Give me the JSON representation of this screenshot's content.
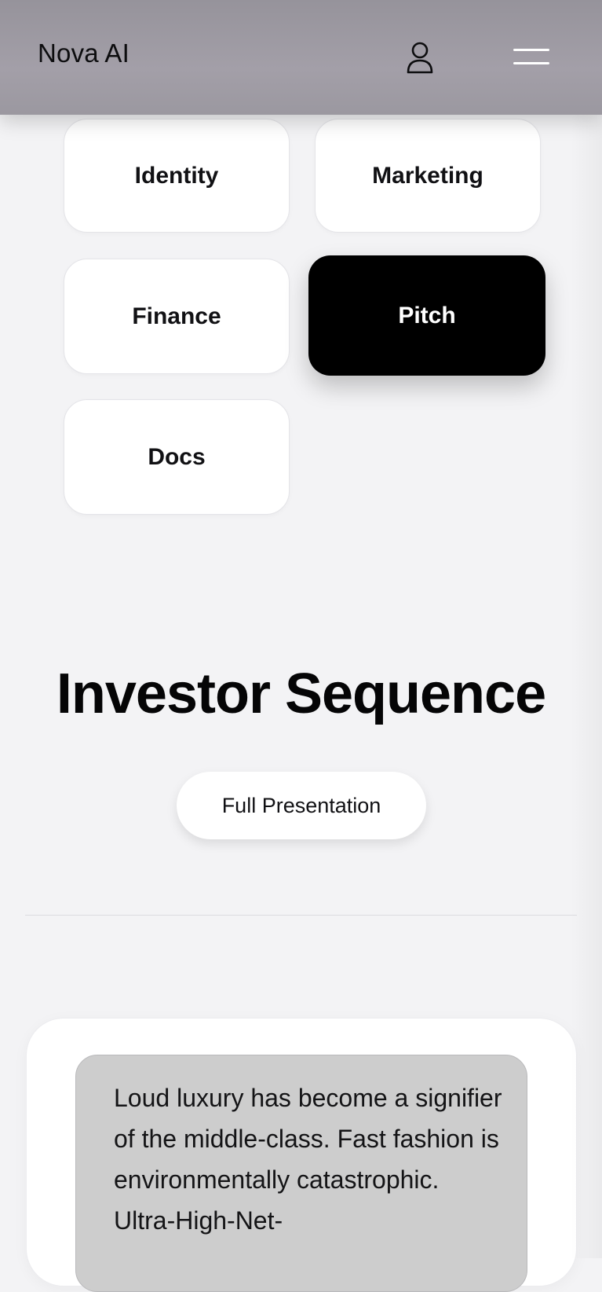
{
  "header": {
    "brand": "Nova AI",
    "profile_icon": "user-icon",
    "menu_icon": "hamburger-menu-icon"
  },
  "categories": {
    "items": [
      {
        "label": "Identity",
        "active": false
      },
      {
        "label": "Marketing",
        "active": false
      },
      {
        "label": "Finance",
        "active": false
      },
      {
        "label": "Pitch",
        "active": true
      },
      {
        "label": "Docs",
        "active": false
      }
    ]
  },
  "section": {
    "title": "Investor Sequence",
    "button_label": "Full Presentation"
  },
  "card": {
    "quote": "Loud luxury has become a signifier of the middle-class. Fast fashion is environmentally catastrophic. Ultra-High-Net-"
  },
  "colors": {
    "header_bg": "#9d9aa2",
    "page_bg": "#f3f3f5",
    "active_tile": "#000000",
    "tile_bg": "#ffffff",
    "quote_bg": "#cdcdcd"
  }
}
